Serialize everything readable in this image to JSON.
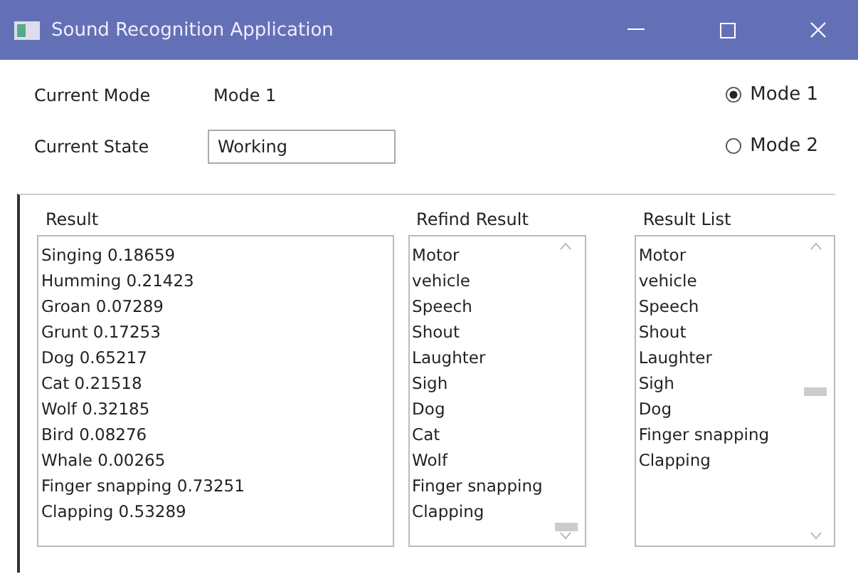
{
  "window": {
    "title": "Sound Recognition Application"
  },
  "fields": [
    {
      "label": "Current Mode",
      "kind": "text",
      "value": "Mode 1"
    },
    {
      "label": "Current State",
      "kind": "input",
      "value": "Working"
    }
  ],
  "modes": [
    {
      "label": "Mode 1",
      "selected": true
    },
    {
      "label": "Mode 2",
      "selected": false
    }
  ],
  "lists": [
    {
      "title": "Result",
      "scrollbar": false,
      "items": [
        "Singing 0.18659",
        "Humming 0.21423",
        "Groan 0.07289",
        "Grunt 0.17253",
        "Dog 0.65217",
        "Cat 0.21518",
        "Wolf 0.32185",
        "Bird 0.08276",
        "Whale 0.00265",
        "Finger snapping 0.73251",
        "Clapping 0.53289"
      ]
    },
    {
      "title": "Refind Result",
      "scrollbar": true,
      "scrolled_to_end": true,
      "items": [
        "Motor",
        "vehicle",
        "Speech",
        "Shout",
        "Laughter",
        "Sigh",
        "Dog",
        "Cat",
        "Wolf",
        "Finger snapping",
        "Clapping"
      ]
    },
    {
      "title": "Result List",
      "scrollbar": true,
      "scrolled_to_end": false,
      "items": [
        "Motor",
        "vehicle",
        "Speech",
        "Shout",
        "Laughter",
        "Sigh",
        "Dog",
        "Finger snapping",
        "Clapping"
      ]
    }
  ]
}
